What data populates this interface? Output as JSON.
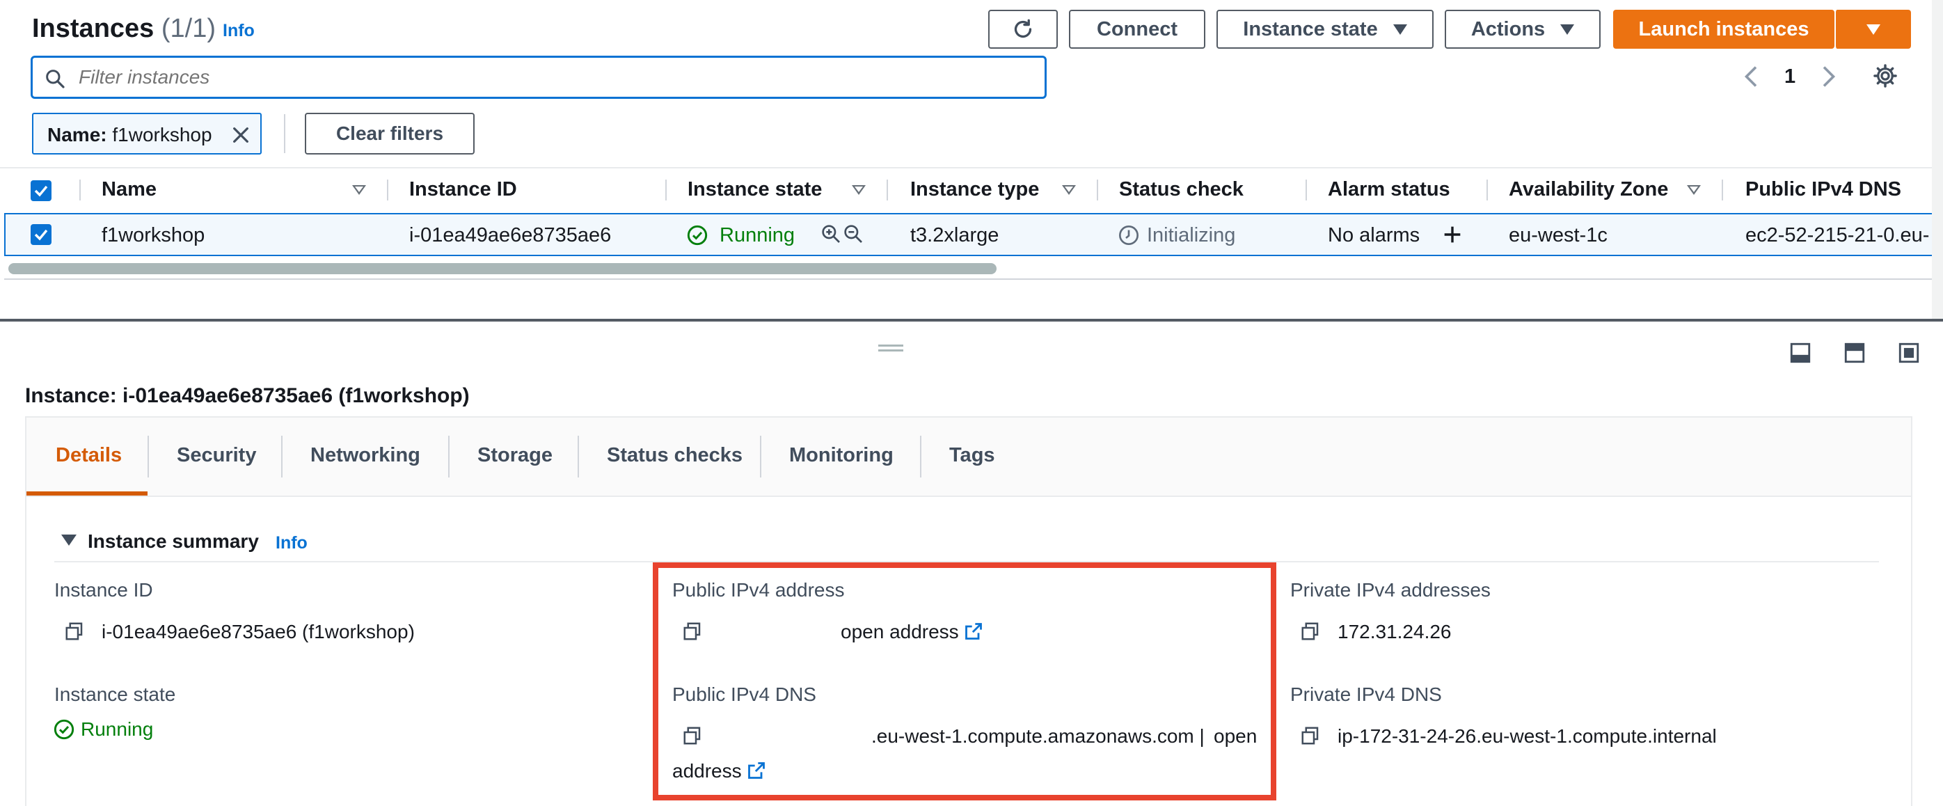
{
  "header": {
    "title": "Instances",
    "count": "(1/1)",
    "info": "Info"
  },
  "toolbar": {
    "connect": "Connect",
    "instance_state": "Instance state",
    "actions": "Actions",
    "launch": "Launch instances"
  },
  "search": {
    "placeholder": "Filter instances"
  },
  "pagination": {
    "page": "1"
  },
  "filter_chip": {
    "key": "Name:",
    "value": "f1workshop"
  },
  "clear_filters": "Clear filters",
  "table": {
    "columns": [
      "Name",
      "Instance ID",
      "Instance state",
      "Instance type",
      "Status check",
      "Alarm status",
      "Availability Zone",
      "Public IPv4 DNS"
    ],
    "row": {
      "name": "f1workshop",
      "instance_id": "i-01ea49ae6e8735ae6",
      "state": "Running",
      "type": "t3.2xlarge",
      "status_check": "Initializing",
      "alarm": "No alarms",
      "az": "eu-west-1c",
      "dns": "ec2-52-215-21-0.eu-"
    }
  },
  "details": {
    "heading": "Instance: i-01ea49ae6e8735ae6 (f1workshop)",
    "tabs": [
      "Details",
      "Security",
      "Networking",
      "Storage",
      "Status checks",
      "Monitoring",
      "Tags"
    ],
    "summary_title": "Instance summary",
    "summary_info": "Info",
    "instance_id_label": "Instance ID",
    "instance_id_value": "i-01ea49ae6e8735ae6 (f1workshop)",
    "instance_state_label": "Instance state",
    "instance_state_value": "Running",
    "public_ipv4_label": "Public IPv4 address",
    "public_ipv4_link": "open address",
    "public_dns_label": "Public IPv4 DNS",
    "public_dns_value": ".eu-west-1.compute.amazonaws.com |",
    "public_dns_link_1": "open",
    "public_dns_link_2": "address",
    "private_ipv4_label": "Private IPv4 addresses",
    "private_ipv4_value": "172.31.24.26",
    "private_dns_label": "Private IPv4 DNS",
    "private_dns_value": "ip-172-31-24-26.eu-west-1.compute.internal"
  },
  "colors": {
    "accent": "#ec7211",
    "link": "#0972d3",
    "success": "#037f0c",
    "highlight": "#e8432e"
  }
}
